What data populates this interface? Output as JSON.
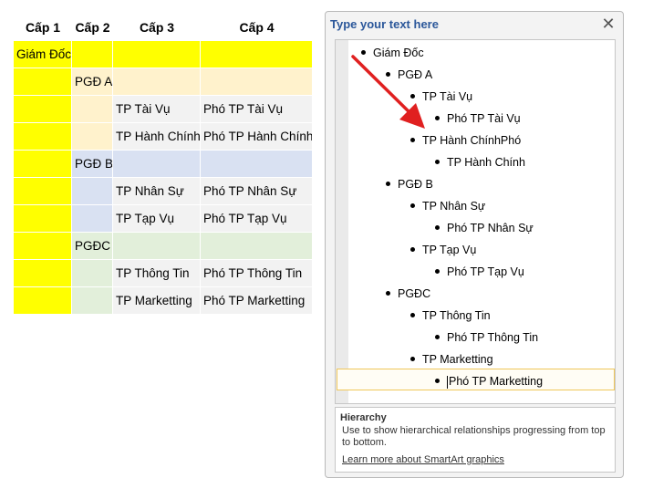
{
  "sheet": {
    "headers": [
      "Cấp 1",
      "Cấp 2",
      "Cấp 3",
      "Cấp 4"
    ],
    "rows": [
      {
        "c1": "Giám Đốc",
        "c2": "",
        "c3": "",
        "c4": "",
        "colors": [
          "#ffff00",
          "#ffff00",
          "#ffff00",
          "#ffff00"
        ]
      },
      {
        "c1": "",
        "c2": "PGĐ A",
        "c3": "",
        "c4": "",
        "colors": [
          "#ffff00",
          "#fff2cc",
          "#fff2cc",
          "#fff2cc"
        ]
      },
      {
        "c1": "",
        "c2": "",
        "c3": "TP Tài Vụ",
        "c4": "Phó TP Tài Vụ",
        "colors": [
          "#ffff00",
          "#fff2cc",
          "#f2f2f2",
          "#f2f2f2"
        ]
      },
      {
        "c1": "",
        "c2": "",
        "c3": "TP Hành Chính",
        "c4": "Phó TP Hành Chính",
        "colors": [
          "#ffff00",
          "#fff2cc",
          "#f2f2f2",
          "#f2f2f2"
        ]
      },
      {
        "c1": "",
        "c2": "PGĐ B",
        "c3": "",
        "c4": "",
        "colors": [
          "#ffff00",
          "#d9e1f2",
          "#d9e1f2",
          "#d9e1f2"
        ]
      },
      {
        "c1": "",
        "c2": "",
        "c3": "TP Nhân Sự",
        "c4": "Phó TP Nhân Sự",
        "colors": [
          "#ffff00",
          "#d9e1f2",
          "#f2f2f2",
          "#f2f2f2"
        ]
      },
      {
        "c1": "",
        "c2": "",
        "c3": "TP Tạp Vụ",
        "c4": "Phó TP Tạp Vụ",
        "colors": [
          "#ffff00",
          "#d9e1f2",
          "#f2f2f2",
          "#f2f2f2"
        ]
      },
      {
        "c1": "",
        "c2": "PGĐC",
        "c3": "",
        "c4": "",
        "colors": [
          "#ffff00",
          "#e2efda",
          "#e2efda",
          "#e2efda"
        ]
      },
      {
        "c1": "",
        "c2": "",
        "c3": "TP Thông Tin",
        "c4": "Phó TP Thông Tin",
        "colors": [
          "#ffff00",
          "#e2efda",
          "#f2f2f2",
          "#f2f2f2"
        ]
      },
      {
        "c1": "",
        "c2": "",
        "c3": "TP Marketting",
        "c4": "Phó TP Marketting",
        "colors": [
          "#ffff00",
          "#e2efda",
          "#f2f2f2",
          "#f2f2f2"
        ]
      }
    ]
  },
  "pane": {
    "title": "Type your text here",
    "close_glyph": "✕",
    "items": [
      {
        "text": "Giám Đốc",
        "level": 1
      },
      {
        "text": "PGĐ A",
        "level": 2
      },
      {
        "text": "TP Tài Vụ",
        "level": 3
      },
      {
        "text": "Phó TP Tài Vụ",
        "level": 4
      },
      {
        "text": "TP Hành ChínhPhó",
        "level": 3
      },
      {
        "text": "TP Hành Chính",
        "level": 4
      },
      {
        "text": "PGĐ B",
        "level": 2
      },
      {
        "text": "TP Nhân Sự",
        "level": 3
      },
      {
        "text": "Phó TP Nhân Sự",
        "level": 4
      },
      {
        "text": "TP Tạp Vụ",
        "level": 3
      },
      {
        "text": "Phó TP Tạp Vụ",
        "level": 4
      },
      {
        "text": "PGĐC",
        "level": 2
      },
      {
        "text": "TP Thông Tin",
        "level": 3
      },
      {
        "text": "Phó TP Thông Tin",
        "level": 4
      },
      {
        "text": "TP Marketting",
        "level": 3
      },
      {
        "text": "Phó TP Marketting",
        "level": 4
      }
    ],
    "selected_index": 15,
    "description": {
      "title": "Hierarchy",
      "text": "Use to show hierarchical relationships progressing from top to bottom.",
      "link": "Learn more about SmartArt graphics"
    }
  },
  "annotation": {
    "type": "arrow",
    "color": "#e02020"
  }
}
